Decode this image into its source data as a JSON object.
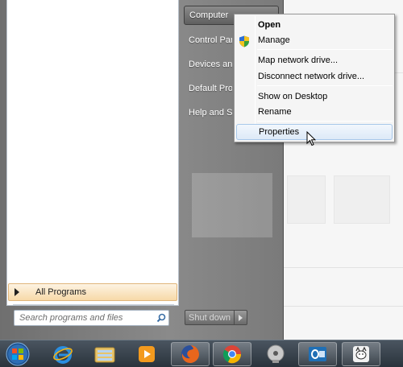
{
  "start_menu": {
    "all_programs_label": "All Programs",
    "search_placeholder": "Search programs and files",
    "right_items": {
      "computer": "Computer",
      "control_panel": "Control Panel",
      "devices": "Devices and Printers",
      "default_programs": "Default Programs",
      "help": "Help and Support"
    },
    "shutdown_label": "Shut down"
  },
  "context_menu": {
    "items": {
      "open": "Open",
      "manage": "Manage",
      "map_drive": "Map network drive...",
      "disconnect_drive": "Disconnect network drive...",
      "show_on_desktop": "Show on Desktop",
      "rename": "Rename",
      "properties": "Properties"
    },
    "highlighted": "Properties"
  },
  "taskbar": {
    "icons": [
      "start-orb",
      "internet-explorer-icon",
      "windows-explorer-icon",
      "media-player-icon",
      "firefox-icon",
      "chrome-icon",
      "media-disc-icon",
      "outlook-icon",
      "cat-app-icon"
    ]
  },
  "colors": {
    "highlight": "#dde9f7",
    "all_programs_bg": "#f7d9a8",
    "taskbar": "#2a333c"
  }
}
